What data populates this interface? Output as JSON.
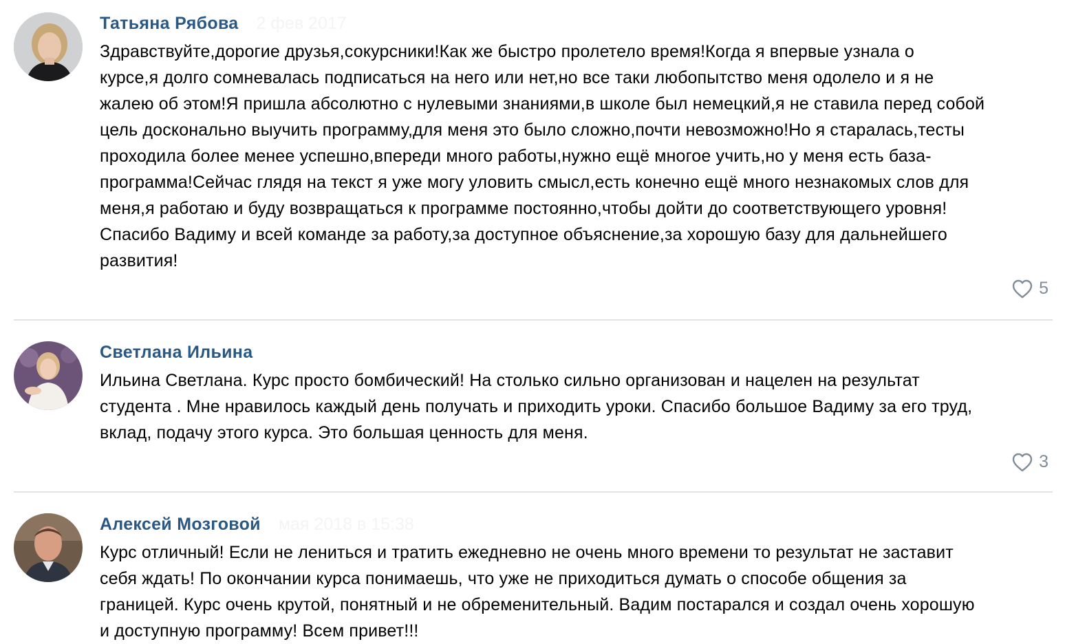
{
  "comments": [
    {
      "author": "Татьяна Рябова",
      "date": "2 фев 2017",
      "text": "Здравствуйте,дорогие друзья,сокурсники!Как же быстро пролетело время!Когда я впервые узнала о\nкурсе,я долго сомневалась подписаться на него или нет,но все таки любопытство меня одолело и я не\nжалею об этом!Я пришла абсолютно с нулевыми знаниями,в школе был немецкий,я не ставила перед собой\nцель досконально выучить программу,для меня это было сложно,почти невозможно!Но я старалась,тесты\nпроходила более менее успешно,впереди много работы,нужно ещё многое учить,но у меня есть база-\nпрограмма!Сейчас глядя на текст я уже могу уловить смысл,есть конечно ещё много незнакомых слов для\nменя,я работаю и буду возвращаться к программе постоянно,чтобы дойти до соответствующего уровня!\nСпасибо Вадиму и всей команде за работу,за доступное объяснение,за хорошую базу для дальнейшего\nразвития!",
      "likes": "5",
      "avatar": "avatar-woman-blonde"
    },
    {
      "author": "Светлана Ильина",
      "date": "",
      "text": "Ильина Светлана. Курс просто бомбический! На столько сильно организован и нацелен на результат\nстудента . Мне нравилось каждый день получать и приходить уроки. Спасибо большое Вадиму за его труд,\nвклад, подачу этого курса. Это большая ценность для меня.",
      "likes": "3",
      "avatar": "avatar-woman-white-dress"
    },
    {
      "author": "Алексей Мозговой",
      "date": "мая 2018 в 15:38",
      "text": "Курс отличный! Если не лениться и тратить ежедневно не очень много времени то результат не заставит\nсебя ждать! По окончании курса понимаешь, что уже не приходиться думать о способе общения за\nграницей. Курс очень крутой, понятный и не обременительный. Вадим постарался и создал очень хорошую\nи доступную программу! Всем привет!!!",
      "avatar": "avatar-man"
    }
  ],
  "colors": {
    "author": "#2a5885",
    "text": "#000000",
    "likes": "#818c99",
    "divider": "#e1e3e6"
  },
  "icons": {
    "like": "heart-outline-icon"
  }
}
